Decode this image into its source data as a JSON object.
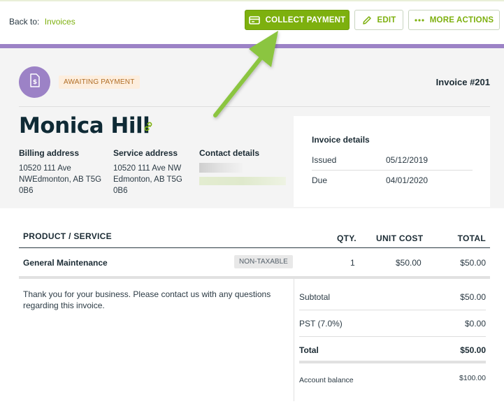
{
  "nav": {
    "back_label": "Back to:",
    "back_link": "Invoices"
  },
  "actions": {
    "collect_payment": "COLLECT PAYMENT",
    "edit": "EDIT",
    "more_actions": "MORE ACTIONS"
  },
  "status": {
    "badge": "AWAITING PAYMENT"
  },
  "invoice": {
    "number": "Invoice #201"
  },
  "client": {
    "name": "Monica Hill"
  },
  "billing": {
    "heading": "Billing address",
    "line1": "10520 111 Ave",
    "line2": "NWEdmonton, AB T5G",
    "line3": "0B6"
  },
  "service": {
    "heading": "Service address",
    "line1": "10520 111 Ave NW",
    "line2": "Edmonton, AB T5G",
    "line3": "0B6"
  },
  "contact": {
    "heading": "Contact details"
  },
  "details": {
    "heading": "Invoice details",
    "issued_label": "Issued",
    "issued_value": "05/12/2019",
    "due_label": "Due",
    "due_value": "04/01/2020"
  },
  "table": {
    "headers": {
      "product": "PRODUCT / SERVICE",
      "qty": "QTY.",
      "unit_cost": "UNIT COST",
      "total": "TOTAL"
    },
    "rows": [
      {
        "name": "General Maintenance",
        "tax": "NON-TAXABLE",
        "qty": "1",
        "unit_cost": "$50.00",
        "total": "$50.00"
      }
    ]
  },
  "note": "Thank you for your business. Please contact us with any questions regarding this invoice.",
  "summary": {
    "subtotal_label": "Subtotal",
    "subtotal_value": "$50.00",
    "tax_label": "PST (7.0%)",
    "tax_value": "$0.00",
    "total_label": "Total",
    "total_value": "$50.00",
    "balance_label": "Account balance",
    "balance_value": "$100.00"
  },
  "colors": {
    "accent_green": "#7db00e",
    "purple": "#9c82c6",
    "badge_bg": "#fdeede",
    "badge_text": "#b06d25",
    "arrow_green": "#8bc53f"
  }
}
